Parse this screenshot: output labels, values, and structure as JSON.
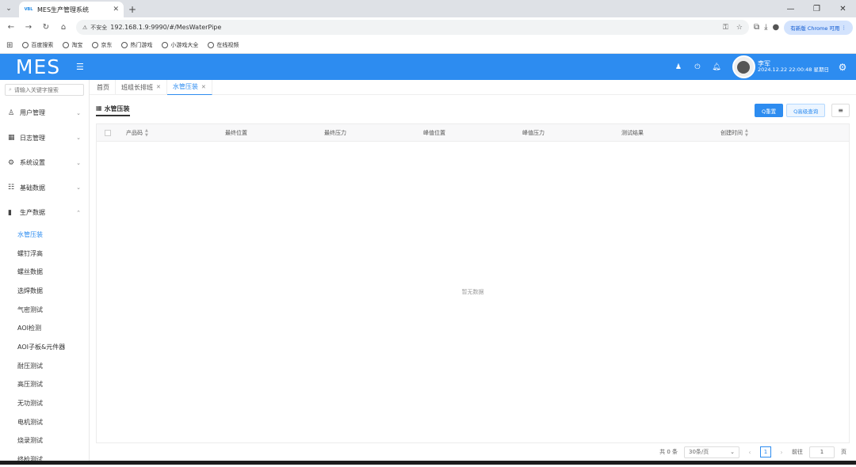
{
  "browser": {
    "tab_title": "MES生产管理系统",
    "tab_favicon": "VBL",
    "url_security": "不安全",
    "url": "192.168.1.9:9990/#/MesWaterPipe",
    "upgrade_label": "有新版 Chrome 可用",
    "bookmarks": [
      "百度搜索",
      "淘宝",
      "京东",
      "热门游戏",
      "小游戏大全",
      "在线视频"
    ]
  },
  "header": {
    "logo": "MES",
    "user_name": "李军",
    "datetime": "2024.12.22 22:00:48 星期日"
  },
  "sidebar": {
    "search_placeholder": "请输入关键字搜索",
    "groups": [
      {
        "label": "用户管理",
        "icon": "user-icon"
      },
      {
        "label": "日志管理",
        "icon": "calendar-icon"
      },
      {
        "label": "系统设置",
        "icon": "settings-icon"
      },
      {
        "label": "基础数据",
        "icon": "sliders-icon"
      },
      {
        "label": "生产数据",
        "icon": "bar-chart-icon"
      }
    ],
    "sub_items": [
      "水管压装",
      "螺钉浮高",
      "螺丝数据",
      "选焊数据",
      "气密测试",
      "AOI检测",
      "AOI子板&元件器",
      "耐压测试",
      "高压测试",
      "无功测试",
      "电机测试",
      "烧录测试",
      "终检测试"
    ],
    "active_sub": "水管压装"
  },
  "tags": [
    {
      "label": "首页",
      "closable": false
    },
    {
      "label": "班组长排班",
      "closable": true
    },
    {
      "label": "水管压装",
      "closable": true
    }
  ],
  "panel": {
    "title": "水管压装",
    "btn_refresh": "Q重置",
    "btn_advanced": "Q高级查询",
    "btn_menu": "≡"
  },
  "table": {
    "columns": [
      {
        "label": "产品码",
        "sortable": true
      },
      {
        "label": "最终位置",
        "sortable": false
      },
      {
        "label": "最终压力",
        "sortable": false
      },
      {
        "label": "峰值位置",
        "sortable": false
      },
      {
        "label": "峰值压力",
        "sortable": false
      },
      {
        "label": "测试结果",
        "sortable": false
      },
      {
        "label": "创建时间",
        "sortable": true
      }
    ],
    "empty_text": "暂无数据"
  },
  "pager": {
    "total": "共 0 条",
    "page_size": "30条/页",
    "current_page": "1",
    "goto_label": "前往",
    "goto_value": "1",
    "page_suffix": "页"
  },
  "colors": {
    "primary": "#2d8cf0",
    "header_bg": "#2d8cf0"
  }
}
